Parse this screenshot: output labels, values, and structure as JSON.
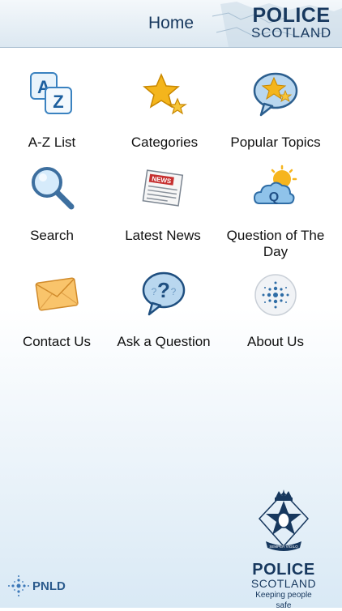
{
  "header": {
    "title": "Home",
    "brand_line1": "POLICE",
    "brand_line2": "SCOTLAND"
  },
  "menu": [
    {
      "label": "A-Z List",
      "icon": "az-icon"
    },
    {
      "label": "Categories",
      "icon": "stars-icon"
    },
    {
      "label": "Popular Topics",
      "icon": "speech-star-icon"
    },
    {
      "label": "Search",
      "icon": "magnifier-icon"
    },
    {
      "label": "Latest News",
      "icon": "newspaper-icon"
    },
    {
      "label": "Question of The Day",
      "icon": "sun-cloud-icon"
    },
    {
      "label": "Contact Us",
      "icon": "envelope-icon"
    },
    {
      "label": "Ask a Question",
      "icon": "question-bubble-icon"
    },
    {
      "label": "About Us",
      "icon": "globe-icon"
    }
  ],
  "footer": {
    "crest_line1": "POLICE",
    "crest_line2": "SCOTLAND",
    "crest_tagline": "Keeping people safe",
    "crest_motto": "SEMPER VIGILO",
    "partner_label": "PNLD"
  },
  "colors": {
    "brand_navy": "#17385e",
    "header_bg": "#dce8f1",
    "page_gradient_end": "#d9e9f5"
  }
}
